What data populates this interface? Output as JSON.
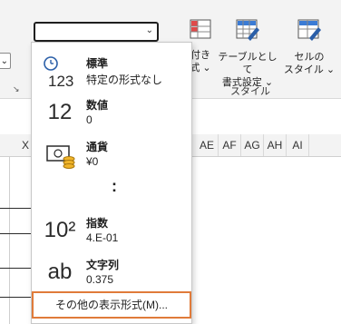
{
  "ribbon": {
    "left_control_glyph": "⌄",
    "group_launcher_glyph": "↘",
    "number_format_value": "",
    "conditional_format_label_line1": "付き",
    "conditional_format_label_line2": "式 ⌄",
    "format_as_table_label_line1": "テーブルとして",
    "format_as_table_label_line2": "書式設定 ⌄",
    "cell_styles_label_line1": "セルの",
    "cell_styles_label_line2": "スタイル ⌄",
    "style_group_label": "スタイル"
  },
  "grid": {
    "columns": [
      "X",
      "AE",
      "AF",
      "AG",
      "AH",
      "AI"
    ]
  },
  "dropdown": {
    "items": [
      {
        "name": "標準",
        "sample": "特定の形式なし",
        "icon": "clock-123-icon",
        "icon_text": "123"
      },
      {
        "name": "数値",
        "sample": "0",
        "icon": "number-12-icon",
        "icon_text": "12"
      },
      {
        "name": "通貨",
        "sample": "¥0",
        "icon": "currency-icon",
        "icon_text": ""
      },
      {
        "name": "指数",
        "sample": "4.E-01",
        "icon": "exponent-icon",
        "icon_text": "10²"
      },
      {
        "name": "文字列",
        "sample": "0.375",
        "icon": "text-ab-icon",
        "icon_text": "ab"
      }
    ],
    "ellipsis": ":",
    "more_formats_label": "その他の表示形式(M)..."
  },
  "colors": {
    "highlight_border": "#e07b3a",
    "ribbon_bg": "#f3f3f3"
  }
}
